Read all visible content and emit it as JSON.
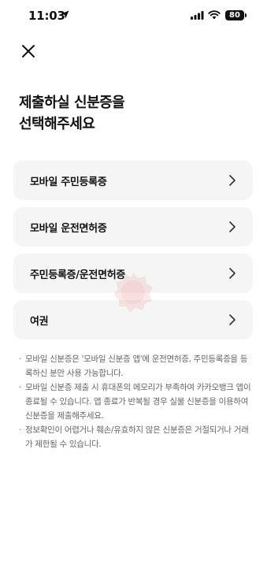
{
  "status_bar": {
    "time": "11:03",
    "battery": "80",
    "icons": [
      "location-arrow-icon",
      "signal-icon",
      "wifi-icon",
      "battery-icon"
    ]
  },
  "header": {
    "close_icon": "close-icon"
  },
  "title": {
    "line1": "제출하실 신분증을",
    "line2": "선택해주세요"
  },
  "options": [
    {
      "label": "모바일 주민등록증"
    },
    {
      "label": "모바일 운전면허증"
    },
    {
      "label": "주민등록증/운전면허증"
    },
    {
      "label": "여권"
    }
  ],
  "notes": [
    "모바일 신분증은 '모바일 신분증 앱'에 운전면허증, 주민등록증을 등록하신 분만 사용 가능합니다.",
    "모바일 신분증 제출 시 휴대폰의 메모리가 부족하여 카카오뱅크 앱이 종료될 수 있습니다. 앱 종료가 반복될 경우 실물 신분증을 이용하여 신분증을 제출해주세요.",
    "정보확인이 어렵거나 훼손/유효하지 않은 신분증은 거절되거나 거래가 제한될 수 있습니다."
  ],
  "colors": {
    "card_background": "#f5f5f5",
    "note_text": "#666666",
    "watermark": "#e88a8a"
  }
}
